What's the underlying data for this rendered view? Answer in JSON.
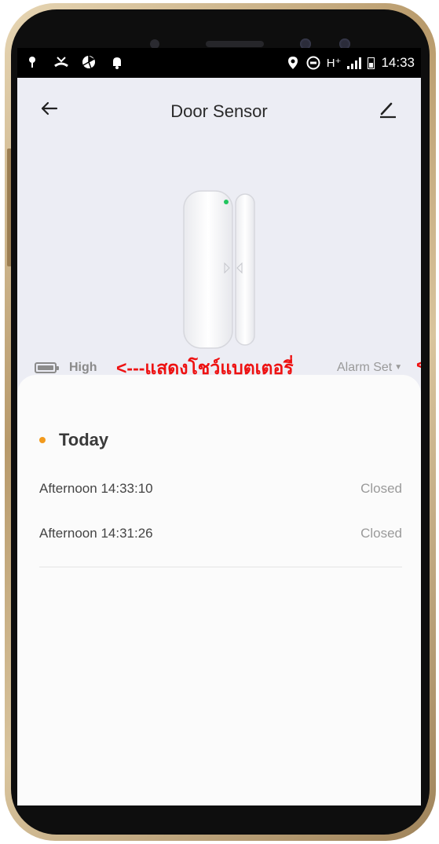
{
  "statusbar": {
    "left_icons": [
      "missed-call-icon",
      "unknown-app-icon",
      "notification-bell-icon"
    ],
    "network": "H⁺",
    "time": "14:33"
  },
  "header": {
    "title": "Door Sensor",
    "back_icon": "back-arrow-icon",
    "edit_icon": "pencil-edit-icon"
  },
  "device": {
    "battery_label": "High",
    "annotation_text": "<---แสดงโชว์แบตเตอรี่",
    "alarm_label": "Alarm Set",
    "annotation_text_2": "<--"
  },
  "history": {
    "section_label": "Today",
    "records": [
      {
        "time": "Afternoon  14:33:10",
        "state": "Closed"
      },
      {
        "time": "Afternoon  14:31:26",
        "state": "Closed"
      }
    ]
  },
  "colors": {
    "screen_bg": "#ecedf4",
    "card_bg": "#fbfbfb",
    "accent_dot": "#f29a1d",
    "annotation": "#ee1111",
    "frame_gold": "#c9ad7e"
  }
}
